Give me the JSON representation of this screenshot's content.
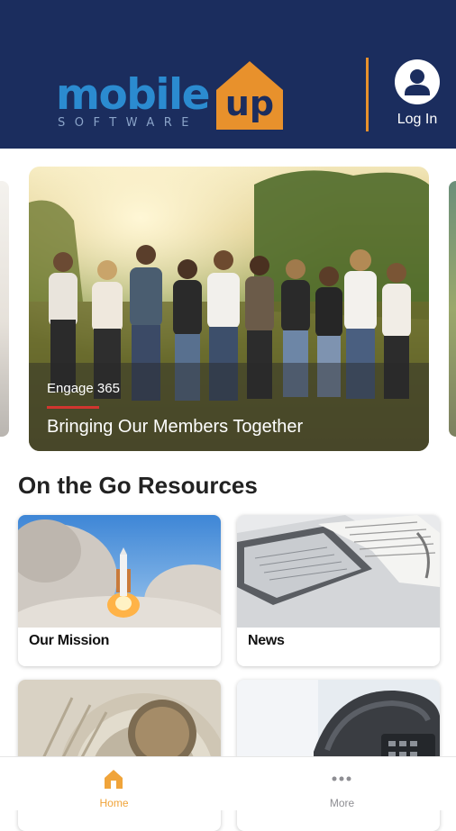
{
  "header": {
    "logo_primary": "mobile",
    "logo_secondary": "up",
    "logo_tagline": "SOFTWARE",
    "login_label": "Log In",
    "login_icon": "user-icon",
    "colors": {
      "background": "#1b2d5e",
      "brand_blue": "#2b8bd0",
      "brand_orange": "#e8912c"
    }
  },
  "carousel": {
    "hero": {
      "eyebrow": "Engage 365",
      "title": "Bringing Our Members Together",
      "accent_color": "#d2362f"
    }
  },
  "resources": {
    "section_title": "On the Go Resources",
    "cards": [
      {
        "label": "Our Mission",
        "image": "rocket-launch"
      },
      {
        "label": "News",
        "image": "newspaper-laptop"
      },
      {
        "label": "",
        "image": "capitol-dome"
      },
      {
        "label": "",
        "image": "desk-phone"
      }
    ]
  },
  "tabbar": {
    "tabs": [
      {
        "label": "Home",
        "icon": "home-icon",
        "active": true
      },
      {
        "label": "More",
        "icon": "more-icon",
        "active": false
      }
    ],
    "active_color": "#f0a43a",
    "inactive_color": "#8e8e93"
  }
}
